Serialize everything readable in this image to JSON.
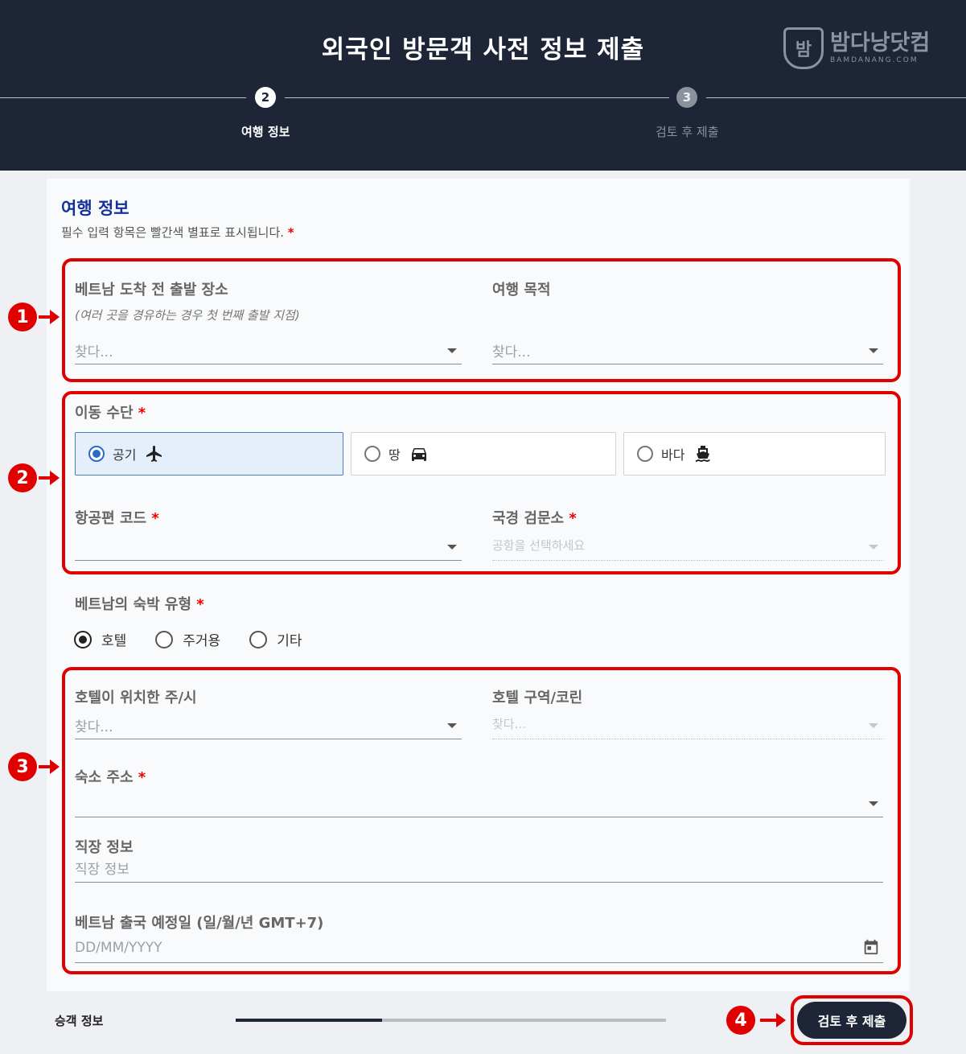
{
  "header": {
    "title": "외국인 방문객 사전 정보 제출",
    "logo_mark": "밤",
    "logo_text": "밤다낭닷컴",
    "logo_sub": "BAMDANANG.COM"
  },
  "stepper": {
    "steps": [
      {
        "number": "2",
        "label": "여행 정보",
        "active": true
      },
      {
        "number": "3",
        "label": "검토 후 제출",
        "active": false
      }
    ]
  },
  "section": {
    "title": "여행 정보",
    "subtitle": "필수 입력 항목은 빨간색 별표로 표시됩니다.",
    "required_mark": "*"
  },
  "fields": {
    "departure": {
      "label": "베트남 도착 전 출발 장소",
      "hint": "(여러 곳을 경유하는 경우 첫 번째 출발 지점)",
      "placeholder": "찾다..."
    },
    "purpose": {
      "label": "여행 목적",
      "placeholder": "찾다..."
    },
    "transport": {
      "label": "이동 수단",
      "options": [
        {
          "label": "공기",
          "icon": "airplane-icon",
          "selected": true
        },
        {
          "label": "땅",
          "icon": "car-icon",
          "selected": false
        },
        {
          "label": "바다",
          "icon": "ship-icon",
          "selected": false
        }
      ]
    },
    "flight_code": {
      "label": "항공편 코드",
      "value": ""
    },
    "border_checkpoint": {
      "label": "국경 검문소",
      "placeholder": "공항을 선택하세요"
    },
    "accommodation_type": {
      "label": "베트남의 숙박 유형",
      "options": [
        {
          "label": "호텔",
          "selected": true
        },
        {
          "label": "주거용",
          "selected": false
        },
        {
          "label": "기타",
          "selected": false
        }
      ]
    },
    "hotel_province": {
      "label": "호텔이 위치한 주/시",
      "placeholder": "찾다..."
    },
    "hotel_district": {
      "label": "호텔 구역/코린",
      "placeholder": "찾다..."
    },
    "lodging_address": {
      "label": "숙소 주소",
      "value": ""
    },
    "work_info": {
      "label": "직장 정보",
      "placeholder": "직장 정보"
    },
    "departure_date": {
      "label": "베트남 출국 예정일 (일/월/년 GMT+7)",
      "placeholder": "DD/MM/YYYY"
    }
  },
  "annotations": [
    "1",
    "2",
    "3",
    "4"
  ],
  "footer": {
    "prev_label": "승객 정보",
    "progress": 0.34,
    "submit_label": "검토 후 제출"
  },
  "colors": {
    "header_bg": "#1e2536",
    "title_blue": "#14309c",
    "required_red": "#e00000",
    "radio_blue": "#2a6cc4"
  }
}
